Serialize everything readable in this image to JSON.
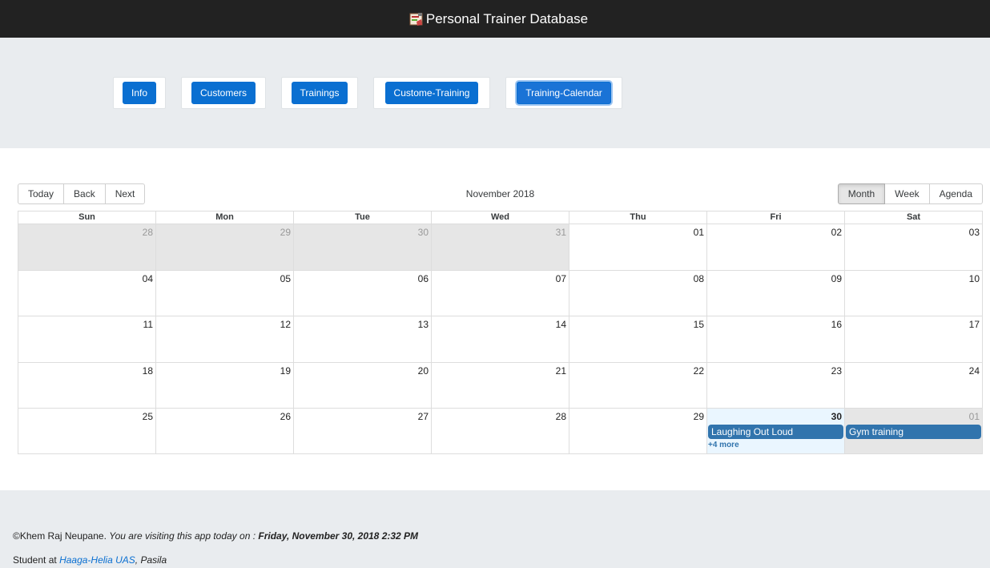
{
  "header": {
    "title": "Personal Trainer Database",
    "logo_icon": "database-logo-icon"
  },
  "nav": {
    "buttons": [
      "Info",
      "Customers",
      "Trainings",
      "Custome-Training",
      "Training-Calendar"
    ],
    "active": "Training-Calendar",
    "accent": "#0a6fd1"
  },
  "toolbar": {
    "today": "Today",
    "back": "Back",
    "next": "Next",
    "label": "November 2018",
    "views": [
      "Month",
      "Week",
      "Agenda"
    ],
    "active_view": "Month"
  },
  "calendar": {
    "weekdays": [
      "Sun",
      "Mon",
      "Tue",
      "Wed",
      "Thu",
      "Fri",
      "Sat"
    ],
    "weeks": [
      [
        "28",
        "29",
        "30",
        "31",
        "01",
        "02",
        "03"
      ],
      [
        "04",
        "05",
        "06",
        "07",
        "08",
        "09",
        "10"
      ],
      [
        "11",
        "12",
        "13",
        "14",
        "15",
        "16",
        "17"
      ],
      [
        "18",
        "19",
        "20",
        "21",
        "22",
        "23",
        "24"
      ],
      [
        "25",
        "26",
        "27",
        "28",
        "29",
        "30",
        "01"
      ]
    ],
    "events": {
      "fri30": "Laughing Out Loud",
      "sat01": "Gym training",
      "fri30_more": "+4 more"
    },
    "event_color": "#3174ad"
  },
  "footer": {
    "author": "©Khem Raj Neupane.",
    "visiting_text": "You are visiting this app today on :",
    "datetime": "Friday, November 30, 2018 2:32 PM",
    "student_prefix": "Student at",
    "school": "Haaga-Helia UAS",
    "campus": ", Pasila"
  }
}
